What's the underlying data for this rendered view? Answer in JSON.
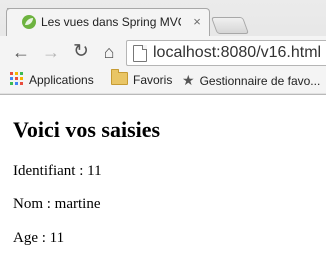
{
  "browser": {
    "tab": {
      "title": "Les vues dans Spring MVC",
      "close": "×"
    },
    "address": {
      "url": "localhost:8080/v16.html"
    },
    "bookmarks": [
      {
        "label": "Applications",
        "icon": "apps-grid-icon"
      },
      {
        "label": "Favoris",
        "icon": "folder-icon"
      },
      {
        "label": "Gestionnaire de favo...",
        "icon": "star-icon"
      }
    ],
    "nav_icons": {
      "back": "←",
      "forward": "→",
      "reload": "↻",
      "home": "⌂"
    }
  },
  "page": {
    "heading": "Voici vos saisies",
    "fields": [
      "Identifiant : 11",
      "Nom : martine",
      "Age : 11"
    ]
  }
}
